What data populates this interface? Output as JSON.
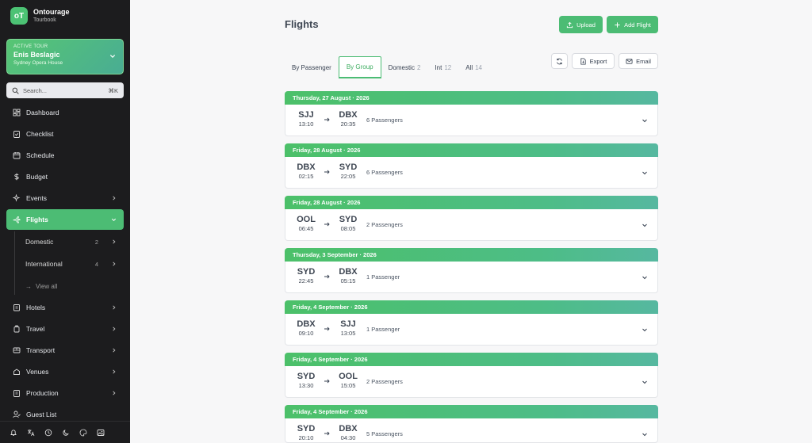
{
  "app": {
    "name": "Ontourage",
    "subtitle": "Tourbook",
    "logo_letters": "oT"
  },
  "tour": {
    "label": "ACTIVE TOUR",
    "name": "Enis Beslagic",
    "venue": "Sydney Opera House"
  },
  "search": {
    "placeholder": "Search...",
    "shortcut": "⌘K"
  },
  "nav": {
    "dashboard": "Dashboard",
    "checklist": "Checklist",
    "schedule": "Schedule",
    "budget": "Budget",
    "events": "Events",
    "flights": "Flights",
    "flights_sub": {
      "domestic": {
        "label": "Domestic",
        "count": "2"
      },
      "international": {
        "label": "International",
        "count": "4"
      },
      "view_all": "View all"
    },
    "hotels": "Hotels",
    "travel": "Travel",
    "transport": "Transport",
    "venues": "Venues",
    "production": "Production",
    "guest_list": "Guest List"
  },
  "page": {
    "title": "Flights",
    "upload": "Upload",
    "add_flight": "Add Flight",
    "export": "Export",
    "email": "Email"
  },
  "tabs": [
    {
      "label": "By Passenger",
      "count": ""
    },
    {
      "label": "By Group",
      "count": ""
    },
    {
      "label": "Domestic",
      "count": "2"
    },
    {
      "label": "Int",
      "count": "12"
    },
    {
      "label": "All",
      "count": "14"
    }
  ],
  "flights": [
    {
      "date": "Thursday, 27 August · 2026",
      "from": "SJJ",
      "dep": "13:10",
      "to": "DBX",
      "arr": "20:35",
      "pax": "6 Passengers"
    },
    {
      "date": "Friday, 28 August · 2026",
      "from": "DBX",
      "dep": "02:15",
      "to": "SYD",
      "arr": "22:05",
      "pax": "6 Passengers"
    },
    {
      "date": "Friday, 28 August · 2026",
      "from": "OOL",
      "dep": "06:45",
      "to": "SYD",
      "arr": "08:05",
      "pax": "2 Passengers"
    },
    {
      "date": "Thursday, 3 September · 2026",
      "from": "SYD",
      "dep": "22:45",
      "to": "DBX",
      "arr": "05:15",
      "pax": "1 Passenger"
    },
    {
      "date": "Friday, 4 September · 2026",
      "from": "DBX",
      "dep": "09:10",
      "to": "SJJ",
      "arr": "13:05",
      "pax": "1 Passenger"
    },
    {
      "date": "Friday, 4 September · 2026",
      "from": "SYD",
      "dep": "13:30",
      "to": "OOL",
      "arr": "15:05",
      "pax": "2 Passengers"
    },
    {
      "date": "Friday, 4 September · 2026",
      "from": "SYD",
      "dep": "20:10",
      "to": "DBX",
      "arr": "04:30",
      "pax": "5 Passengers"
    }
  ],
  "colors": {
    "accent": "#4cbc74",
    "sidebar": "#1c1c1e",
    "text": "#3f4753"
  }
}
